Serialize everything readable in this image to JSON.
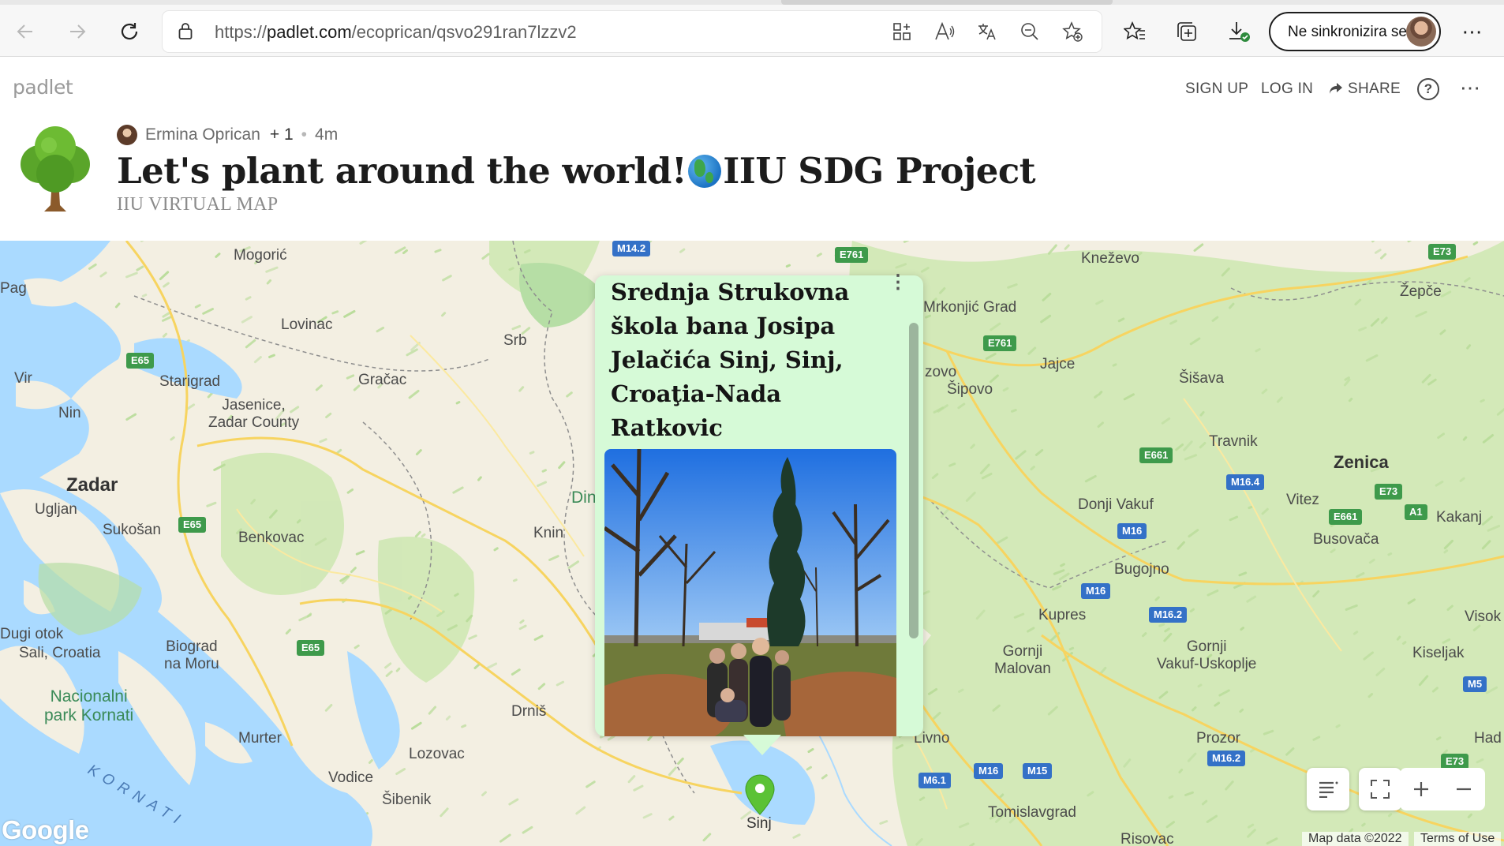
{
  "browser": {
    "url_prefix": "https://",
    "url_host": "padlet.com",
    "url_path": "/ecoprican/qsvo291ran7lzzv2",
    "profile_label": "Ne sinkronizira se",
    "icons": [
      "back-icon",
      "forward-icon",
      "refresh-icon",
      "lock-icon",
      "apps-icon",
      "read-aloud-icon",
      "translate-icon",
      "zoom-out-icon",
      "add-favorite-icon",
      "favorites-icon",
      "collections-icon",
      "downloads-icon",
      "more-icon"
    ]
  },
  "padlet": {
    "logo": "padlet",
    "nav": {
      "sign_up": "SIGN UP",
      "log_in": "LOG IN",
      "share": "SHARE"
    },
    "author": "Ermina Oprican",
    "collaborators": "+ 1",
    "time": "4m",
    "title_part1": "Let's plant around the world!",
    "title_part2": "IIU SDG Project",
    "subtitle": "IIU VIRTUAL MAP"
  },
  "map": {
    "places": {
      "mogoric": "Mogorić",
      "lovinac": "Lovinac",
      "pag": "Pag",
      "starigrad": "Starigrad",
      "gracac": "Gračac",
      "vir": "Vir",
      "nin": "Nin",
      "jasenice": "Jasenice,\nZadar County",
      "zadar": "Zadar",
      "ugljan": "Ugljan",
      "sukosan": "Sukošan",
      "benkovac": "Benkovac",
      "knin": "Knin",
      "din": "Din",
      "srb": "Srb",
      "dugi_otok": "Dugi otok",
      "sali": "Sali, Croatia",
      "biograd": "Biograd\nna Moru",
      "kornati_park": "Nacionalni\npark Kornati",
      "drnis": "Drniš",
      "murter": "Murter",
      "lozovac": "Lozovac",
      "vodice": "Vodice",
      "sibenik": "Šibenik",
      "kornati": "KORNATI",
      "knezevo": "Kneževo",
      "mrkonjic": "Mrkonjić Grad",
      "zepce": "Žepče",
      "jajce": "Jajce",
      "zovo": "zovo",
      "sipovo": "Šipovo",
      "sisava": "Šišava",
      "travnik": "Travnik",
      "zenica": "Zenica",
      "vitez": "Vitez",
      "kakanj": "Kakanj",
      "donji_vakuf": "Donji Vakuf",
      "busovaca": "Busovača",
      "bugojno": "Bugojno",
      "kupres": "Kupres",
      "gornji_malovan": "Gornji\nMalovan",
      "gornji_vakuf": "Gornji\nVakuf-Uskoplje",
      "visok": "Visok",
      "kiseljak": "Kiseljak",
      "livno": "Livno",
      "prozor": "Prozor",
      "had": "Had",
      "tomislavgrad": "Tomislavgrad",
      "risovac": "Risovac",
      "sinj": "Sinj"
    },
    "routes": {
      "m142": "M14.2",
      "e761a": "E761",
      "e73a": "E73",
      "e65a": "E65",
      "e761b": "E761",
      "e65b": "E65",
      "e661a": "E661",
      "m164": "M16.4",
      "e73b": "E73",
      "e661b": "E661",
      "a1": "A1",
      "m16a": "M16",
      "m16b": "M16",
      "m162a": "M16.2",
      "e65c": "E65",
      "m5": "M5",
      "m61": "M6.1",
      "m16c": "M16",
      "m15": "M15",
      "m162b": "M16.2",
      "e73c": "E73"
    },
    "post": {
      "title": "Srednja Strukovna škola bana Josipa Jelačića Sinj, Sinj, Croaţia-Nada Ratkovic"
    },
    "pin_label": "Sinj",
    "google": "Google",
    "map_data": "Map data ©2022",
    "terms": "Terms of Use",
    "colors": {
      "water": "#aadaff",
      "land": "#f3efe2",
      "forest": "#cfe8b4",
      "park": "#b6dea5",
      "card": "#d6fad7",
      "pin": "#5bc236"
    }
  }
}
